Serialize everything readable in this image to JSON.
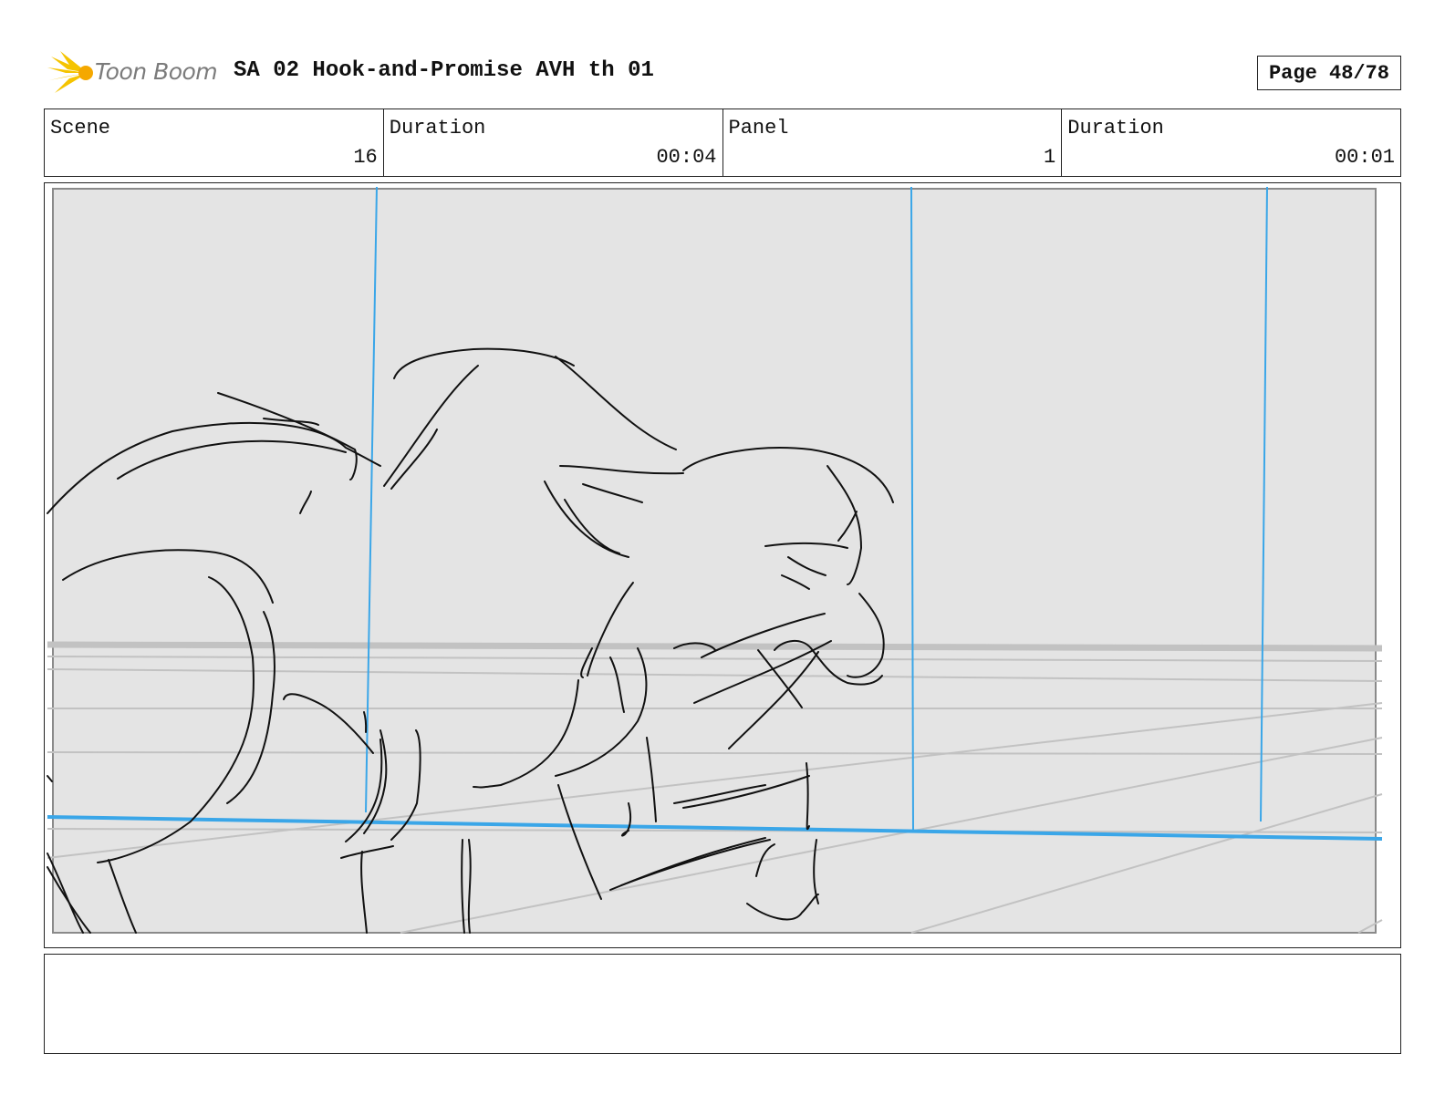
{
  "brand": {
    "name": "Toon Boom",
    "accent": "#f5c400"
  },
  "document": {
    "title": "SA 02 Hook-and-Promise AVH th 01"
  },
  "page": {
    "label": "Page 48/78"
  },
  "info": {
    "scene_label": "Scene",
    "scene_value": "16",
    "scene_duration_label": "Duration",
    "scene_duration_value": "00:04",
    "panel_label": "Panel",
    "panel_value": "1",
    "panel_duration_label": "Duration",
    "panel_duration_value": "00:01"
  },
  "panel": {
    "background_color": "#e4e4e4",
    "guide_color": "#3aa6e8",
    "sketch_color": "#111111",
    "icon": "storyboard-sketch"
  },
  "notes": {
    "text": ""
  }
}
